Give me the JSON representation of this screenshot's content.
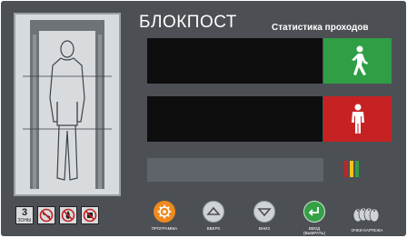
{
  "brand": {
    "name": "БЛОКПОСТ"
  },
  "header": {
    "subtitle": "Статистика проходов"
  },
  "zones": {
    "count_number": "3",
    "count_label": "ЗОНЫ",
    "icons": [
      "no-metal-icon",
      "no-fire-icon",
      "no-entry-icon"
    ]
  },
  "displays": {
    "top_icon": "walking-person-icon",
    "bottom_icon": "standing-person-icon"
  },
  "controls": {
    "program_label": "ПРОГРАММА",
    "up_label": "ВВЕРХ",
    "down_label": "ВНИЗ",
    "enter_label": "ВВОД",
    "enter_sublabel": "(ВЫБРАТЬ)",
    "keys_label": "ОЧКИ КАРТЕЖА"
  },
  "colors": {
    "panel": "#4c5055",
    "go": "#2f9e45",
    "stop": "#c62223",
    "program_button": "#f08a1c",
    "enter_button": "#35a046",
    "nav_button": "#cfd3d6",
    "indicator": [
      "#c62223",
      "#f2c31a",
      "#2f9e45"
    ]
  }
}
